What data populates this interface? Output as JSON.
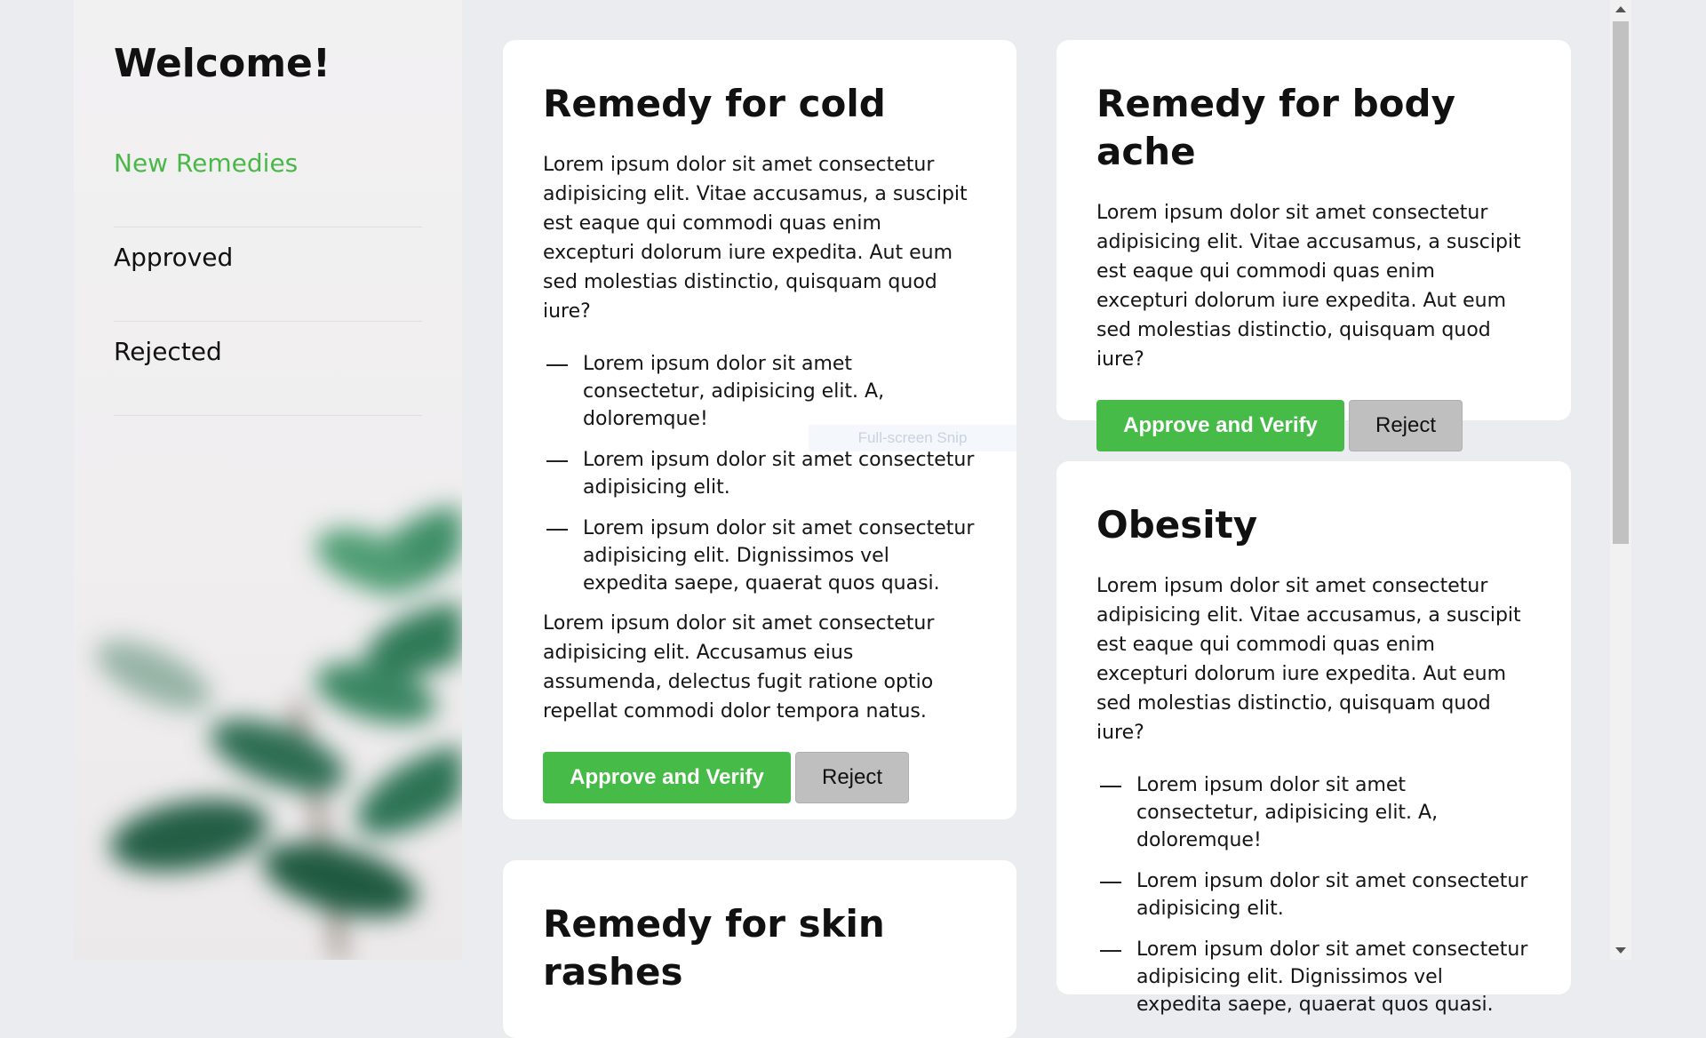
{
  "sidebar": {
    "title": "Welcome!",
    "nav": [
      {
        "label": "New Remedies",
        "active": true
      },
      {
        "label": "Approved",
        "active": false
      },
      {
        "label": "Rejected",
        "active": false
      }
    ],
    "accent_color": "#4ab849"
  },
  "cards": [
    {
      "title": "Remedy for cold",
      "description": "Lorem ipsum dolor sit amet consectetur adipisicing elit. Vitae accusamus, a suscipit est eaque qui commodi quas enim excepturi dolorum iure expedita. Aut eum sed molestias distinctio, quisquam quod iure?",
      "items": [
        "Lorem ipsum dolor sit amet consectetur, adipisicing elit. A, doloremque!",
        "Lorem ipsum dolor sit amet consectetur adipisicing elit.",
        "Lorem ipsum dolor sit amet consectetur adipisicing elit. Dignissimos vel expedita saepe, quaerat quos quasi."
      ],
      "notes": "Lorem ipsum dolor sit amet consectetur adipisicing elit. Accusamus eius assumenda, delectus fugit ratione optio repellat commodi dolor tempora natus.",
      "approve_label": "Approve and Verify",
      "reject_label": "Reject"
    },
    {
      "title": "Remedy for body ache",
      "description": "Lorem ipsum dolor sit amet consectetur adipisicing elit. Vitae accusamus, a suscipit est eaque qui commodi quas enim excepturi dolorum iure expedita. Aut eum sed molestias distinctio, quisquam quod iure?",
      "approve_label": "Approve and Verify",
      "reject_label": "Reject"
    },
    {
      "title": "Obesity",
      "description": "Lorem ipsum dolor sit amet consectetur adipisicing elit. Vitae accusamus, a suscipit est eaque qui commodi quas enim excepturi dolorum iure expedita. Aut eum sed molestias distinctio, quisquam quod iure?",
      "items": [
        "Lorem ipsum dolor sit amet consectetur, adipisicing elit. A, doloremque!",
        "Lorem ipsum dolor sit amet consectetur adipisicing elit.",
        "Lorem ipsum dolor sit amet consectetur adipisicing elit. Dignissimos vel expedita saepe, quaerat quos quasi."
      ]
    },
    {
      "title": "Remedy for skin rashes"
    }
  ],
  "overlay": {
    "snip_label": "Full-screen Snip"
  },
  "colors": {
    "approve": "#47bb47",
    "reject": "#bfbfbf",
    "background": "#ebecf0"
  }
}
